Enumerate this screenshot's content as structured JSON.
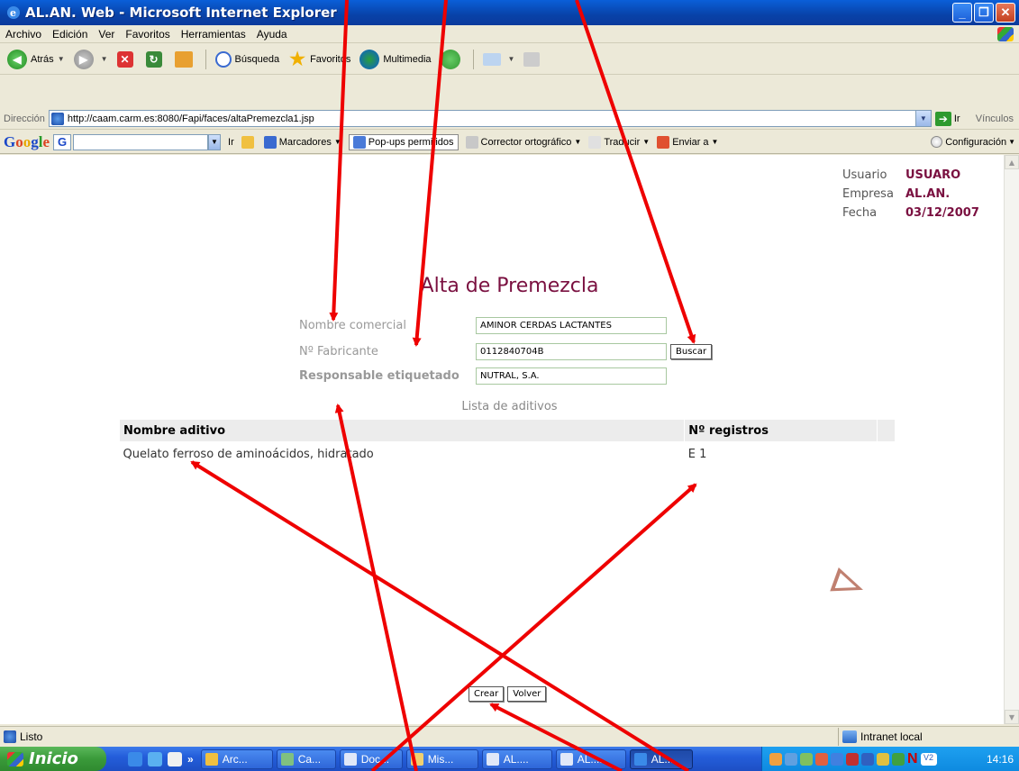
{
  "window": {
    "title": "AL.AN. Web - Microsoft Internet Explorer",
    "min": "_",
    "max": "❐",
    "close": "✕"
  },
  "menu": [
    "Archivo",
    "Edición",
    "Ver",
    "Favoritos",
    "Herramientas",
    "Ayuda"
  ],
  "toolbar": {
    "back": "Atrás",
    "search": "Búsqueda",
    "favorites": "Favoritos",
    "multimedia": "Multimedia"
  },
  "address": {
    "label": "Dirección",
    "url": "http://caam.carm.es:8080/Fapi/faces/altaPremezcla1.jsp",
    "go": "Ir",
    "links": "Vínculos"
  },
  "google": {
    "logo": {
      "g1": "G",
      "o1": "o",
      "o2": "o",
      "g2": "g",
      "l": "l",
      "e": "e"
    },
    "g_button": "G",
    "go": "Ir",
    "bookmarks": "Marcadores",
    "popups": "Pop-ups permitidos",
    "spell": "Corrector ortográfico",
    "translate": "Traducir",
    "send": "Enviar a",
    "config": "Configuración"
  },
  "user": {
    "usuario_label": "Usuario",
    "usuario": "USUARO",
    "empresa_label": "Empresa",
    "empresa": "AL.AN.",
    "fecha_label": "Fecha",
    "fecha": "03/12/2007"
  },
  "page": {
    "title": "Alta de Premezcla"
  },
  "form": {
    "nombre_label": "Nombre comercial",
    "nombre_value": "AMINOR CERDAS LACTANTES",
    "fabricante_label": "Nº Fabricante",
    "fabricante_value": "0112840704B",
    "buscar": "Buscar",
    "responsable_label": "Responsable etiquetado",
    "responsable_value": "NUTRAL, S.A."
  },
  "list": {
    "title": "Lista de aditivos",
    "headers": [
      "Nombre aditivo",
      "Nº registros"
    ],
    "rows": [
      {
        "nombre": "Quelato ferroso de aminoácidos, hidratado",
        "registros": "E 1"
      }
    ]
  },
  "buttons": {
    "crear": "Crear",
    "volver": "Volver"
  },
  "status": {
    "text": "Listo",
    "zone": "Intranet local"
  },
  "taskbar": {
    "start": "Inicio",
    "tasks": [
      "Arc...",
      "Ca...",
      "Doc...",
      "Mis...",
      "AL....",
      "AL....",
      "AL...."
    ],
    "clock": "14:16",
    "n_badge": "N",
    "v_badge": "V2"
  }
}
